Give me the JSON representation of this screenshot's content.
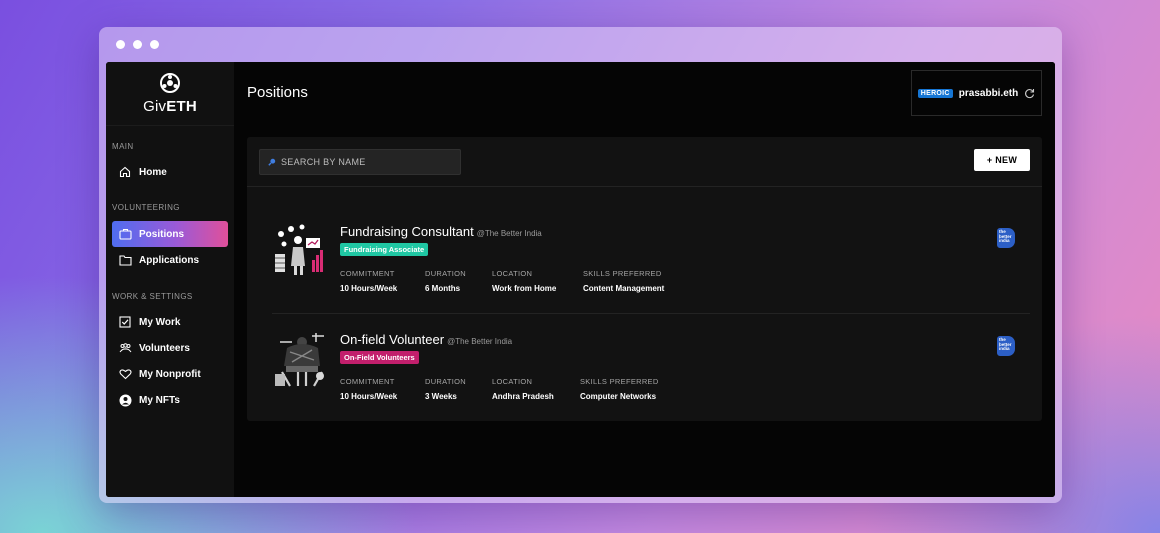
{
  "brand": {
    "name_prefix": "Giv",
    "name_suffix": "ETH"
  },
  "sidebar": {
    "sections": [
      {
        "label": "MAIN",
        "items": [
          {
            "label": "Home",
            "icon": "home-icon"
          }
        ]
      },
      {
        "label": "VOLUNTEERING",
        "items": [
          {
            "label": "Positions",
            "icon": "briefcase-icon",
            "active": true
          },
          {
            "label": "Applications",
            "icon": "folder-icon"
          }
        ]
      },
      {
        "label": "WORK & SETTINGS",
        "items": [
          {
            "label": "My Work",
            "icon": "checkbox-icon"
          },
          {
            "label": "Volunteers",
            "icon": "people-icon"
          },
          {
            "label": "My Nonprofit",
            "icon": "heart-icon"
          },
          {
            "label": "My NFTs",
            "icon": "user-circle-icon"
          }
        ]
      }
    ]
  },
  "header": {
    "title": "Positions",
    "user": {
      "badge": "HEROIC",
      "name": "prasabbi.eth",
      "refresh_icon": "refresh-icon"
    }
  },
  "toolbar": {
    "search_placeholder": "SEARCH BY NAME",
    "new_label": "+ NEW"
  },
  "meta_labels": {
    "commitment": "COMMITMENT",
    "duration": "DURATION",
    "location": "LOCATION",
    "skills": "SKILLS PREFERRED"
  },
  "positions": [
    {
      "title": "Fundraising Consultant",
      "org": "@The Better India",
      "tag": "Fundraising Associate",
      "tag_color": "#1fc7a3",
      "commitment": "10 Hours/Week",
      "duration": "6 Months",
      "location": "Work from Home",
      "skills": "Content Management"
    },
    {
      "title": "On-field Volunteer",
      "org": "@The Better India",
      "tag": "On-Field Volunteers",
      "tag_color": "#c21f6c",
      "commitment": "10 Hours/Week",
      "duration": "3 Weeks",
      "location": "Andhra Pradesh",
      "skills": "Computer Networks"
    }
  ],
  "org_logo_text": [
    "the",
    "better",
    "india"
  ],
  "colors": {
    "accent_start": "#4f6df0",
    "accent_end": "#e0509a",
    "background": "#000000"
  }
}
